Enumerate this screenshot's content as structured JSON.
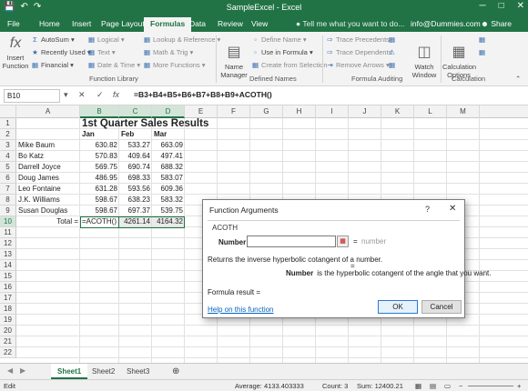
{
  "window": {
    "title": "SampleExcel - Excel",
    "qat": [
      "save-icon",
      "undo-icon",
      "redo-icon"
    ],
    "controls": [
      "─",
      "□",
      "✕"
    ]
  },
  "tabs": {
    "file": "File",
    "home": "Home",
    "insert": "Insert",
    "page_layout": "Page Layout",
    "formulas": "Formulas",
    "data": "Data",
    "review": "Review",
    "view": "View",
    "tell_me": "Tell me what you want to do...",
    "account": "info@Dummies.com",
    "share": "Share"
  },
  "ribbon": {
    "insert_function": "Insert Function",
    "autosum": "AutoSum",
    "recently_used": "Recently Used",
    "financial": "Financial",
    "logical": "Logical",
    "text": "Text",
    "date_time": "Date & Time",
    "lookup_ref": "Lookup & Reference",
    "math_trig": "Math & Trig",
    "more_functions": "More Functions",
    "group_function_library": "Function Library",
    "name_manager": "Name Manager",
    "define_name": "Define Name",
    "use_in_formula": "Use in Formula",
    "create_from_selection": "Create from Selection",
    "group_defined_names": "Defined Names",
    "trace_precedents": "Trace Precedents",
    "trace_dependents": "Trace Dependents",
    "remove_arrows": "Remove Arrows",
    "group_formula_auditing": "Formula Auditing",
    "watch_window": "Watch Window",
    "calc_options": "Calculation Options",
    "group_calculation": "Calculation"
  },
  "formula_bar": {
    "name_box": "B10",
    "cancel": "✕",
    "enter": "✓",
    "fx": "fx",
    "formula": "=B3+B4+B5+B6+B7+B8+B9+ACOTH()"
  },
  "sheet": {
    "columns": [
      "A",
      "B",
      "C",
      "D",
      "E",
      "F",
      "G",
      "H",
      "I",
      "J",
      "K",
      "L",
      "M"
    ],
    "rows": [
      "1",
      "2",
      "3",
      "4",
      "5",
      "6",
      "7",
      "8",
      "9",
      "10",
      "11",
      "12",
      "13",
      "14",
      "15",
      "16",
      "17",
      "18",
      "19",
      "20",
      "21",
      "22"
    ],
    "title": "1st Quarter Sales Results",
    "headers": [
      "Jan",
      "Feb",
      "Mar"
    ],
    "data": [
      {
        "name": "Mike Baum",
        "jan": "630.82",
        "feb": "533.27",
        "mar": "663.09"
      },
      {
        "name": "Bo Katz",
        "jan": "570.83",
        "feb": "409.64",
        "mar": "497.41"
      },
      {
        "name": "Darrell Joyce",
        "jan": "569.75",
        "feb": "690.74",
        "mar": "688.32"
      },
      {
        "name": "Doug James",
        "jan": "486.95",
        "feb": "698.33",
        "mar": "583.07"
      },
      {
        "name": "Leo Fontaine",
        "jan": "631.28",
        "feb": "593.56",
        "mar": "609.36"
      },
      {
        "name": "J.K. Williams",
        "jan": "598.67",
        "feb": "638.23",
        "mar": "583.32"
      },
      {
        "name": "Susan Douglas",
        "jan": "598.67",
        "feb": "697.37",
        "mar": "539.75"
      }
    ],
    "total_label": "Total =",
    "total_b": "=ACOTH()",
    "total_c": "4261.14",
    "total_d": "4164.32"
  },
  "sheet_tabs": [
    "Sheet1",
    "Sheet2",
    "Sheet3"
  ],
  "add_sheet": "⊕",
  "status": {
    "mode": "Edit",
    "average": "Average: 4133.403333",
    "count": "Count: 3",
    "sum": "Sum: 12400.21"
  },
  "dialog": {
    "title": "Function Arguments",
    "help": "?",
    "close": "✕",
    "function_name": "ACOTH",
    "arg_label": "Number",
    "arg_value": "",
    "arg_eq": "=",
    "arg_result": "number",
    "eq2": "=",
    "description": "Returns the inverse hyperbolic cotangent of a number.",
    "arg_desc_name": "Number",
    "arg_desc_text": "is the hyperbolic cotangent of the angle that you want.",
    "formula_result": "Formula result =",
    "help_link": "Help on this function",
    "ok": "OK",
    "cancel": "Cancel"
  },
  "colors": {
    "accent": "#217346",
    "link": "#0563c1"
  }
}
